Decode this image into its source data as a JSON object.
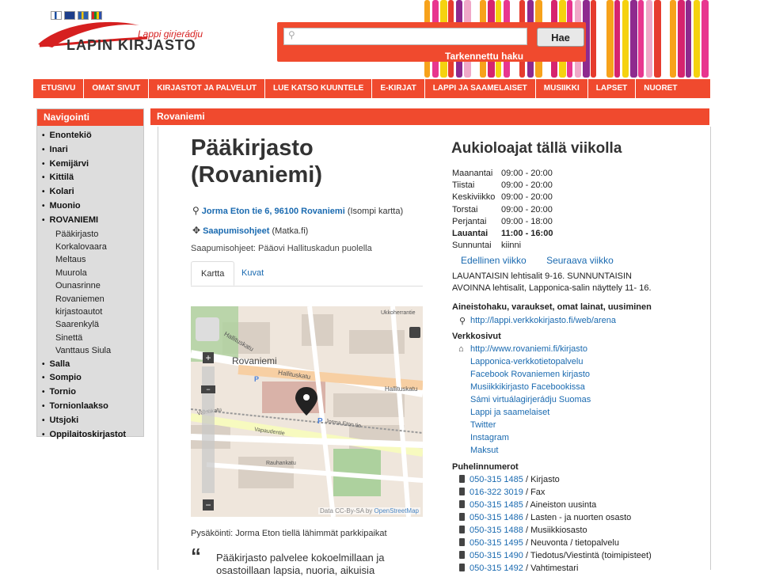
{
  "header": {
    "flags": [
      "fi",
      "gb",
      "se",
      "sa"
    ],
    "logo_sub": "Lappi girjerádju",
    "logo_main": "LAPIN KIRJASTO",
    "search_placeholder": "",
    "search_button": "Hae",
    "advanced_search": "Tarkennettu haku"
  },
  "nav": [
    "ETUSIVU",
    "OMAT SIVUT",
    "KIRJASTOT JA PALVELUT",
    "LUE KATSO KUUNTELE",
    "E-KIRJAT",
    "LAPPI JA SAAMELAISET",
    "MUSIIKKI",
    "LAPSET",
    "NUORET"
  ],
  "sidebar": {
    "title": "Navigointi",
    "items": [
      {
        "label": "Enontekiö",
        "level": "top"
      },
      {
        "label": "Inari",
        "level": "top"
      },
      {
        "label": "Kemijärvi",
        "level": "top"
      },
      {
        "label": "Kittilä",
        "level": "top"
      },
      {
        "label": "Kolari",
        "level": "top"
      },
      {
        "label": "Muonio",
        "level": "top"
      },
      {
        "label": "ROVANIEMI",
        "level": "top"
      },
      {
        "label": "Pääkirjasto",
        "level": "sub"
      },
      {
        "label": "Korkalovaara",
        "level": "sub"
      },
      {
        "label": "Meltaus",
        "level": "sub"
      },
      {
        "label": "Muurola",
        "level": "sub"
      },
      {
        "label": "Ounasrinne",
        "level": "sub"
      },
      {
        "label": "Rovaniemen",
        "level": "sub"
      },
      {
        "label": "kirjastoautot",
        "level": "sub"
      },
      {
        "label": "Saarenkylä",
        "level": "sub"
      },
      {
        "label": "Sinettä",
        "level": "sub"
      },
      {
        "label": "Vanttaus Siula",
        "level": "sub"
      },
      {
        "label": "Salla",
        "level": "top"
      },
      {
        "label": "Sompio",
        "level": "top"
      },
      {
        "label": "Tornio",
        "level": "top"
      },
      {
        "label": "Tornionlaakso",
        "level": "top"
      },
      {
        "label": "Utsjoki",
        "level": "top"
      },
      {
        "label": "Oppilaitoskirjastot",
        "level": "top"
      }
    ]
  },
  "main": {
    "section_title": "Rovaniemi",
    "title": "Pääkirjasto (Rovaniemi)",
    "address_link": "Jorma Eton tie 6, 96100 Rovaniemi",
    "address_extra": "(Isompi kartta)",
    "directions_link": "Saapumisohjeet",
    "directions_extra": "(Matka.fi)",
    "arrival": "Saapumisohjeet: Pääovi Hallituskadun puolella",
    "tabs": [
      "Kartta",
      "Kuvat"
    ],
    "map": {
      "labels": [
        "Rovaniemi",
        "Hallituskatu",
        "Hallituskatu",
        "Hallituskatu",
        "Jorma Eton tie",
        "Väinäkatu",
        "Vapaudentie",
        "Rauhankatu",
        "Ukkoherrantie"
      ],
      "credit_prefix": "Data CC-By-SA by",
      "credit_link": "OpenStreetMap",
      "zoom_in": "+",
      "zoom_out": "−",
      "zoom_out_bottom": "−"
    },
    "parking": "Pysäköinti: Jorma Eton tiellä lähimmät parkkipaikat",
    "quote": "Pääkirjasto palvelee kokoelmillaan ja osastoillaan lapsia, nuoria, aikuisia"
  },
  "hours": {
    "title": "Aukioloajat tällä viikolla",
    "rows": [
      {
        "day": "Maanantai",
        "time": "09:00 - 20:00",
        "today": false
      },
      {
        "day": "Tiistai",
        "time": "09:00 - 20:00",
        "today": false
      },
      {
        "day": "Keskiviikko",
        "time": "09:00 - 20:00",
        "today": false
      },
      {
        "day": "Torstai",
        "time": "09:00 - 20:00",
        "today": false
      },
      {
        "day": "Perjantai",
        "time": "09:00 - 18:00",
        "today": false
      },
      {
        "day": "Lauantai",
        "time": "11:00 - 16:00",
        "today": true
      },
      {
        "day": "Sunnuntai",
        "time": "kiinni",
        "today": false
      }
    ],
    "prev_week": "Edellinen viikko",
    "next_week": "Seuraava viikko",
    "notice": "LAUANTAISIN lehtisalit 9-16. SUNNUNTAISIN AVOINNA lehtisalit, Lapponica-salin näyttely 11- 16."
  },
  "services": {
    "heading": "Aineistohaku, varaukset, omat lainat, uusiminen",
    "link": "http://lappi.verkkokirjasto.fi/web/arena"
  },
  "websites": {
    "heading": "Verkkosivut",
    "links": [
      "http://www.rovaniemi.fi/kirjasto",
      "Lapponica-verkkotietopalvelu",
      "Facebook Rovaniemen kirjasto",
      "Musiikkikirjasto Facebookissa",
      "Sámi virtuálagirjerádju Suomas",
      "Lappi ja saamelaiset",
      "Twitter",
      "Instagram",
      "Maksut"
    ]
  },
  "phones": {
    "heading": "Puhelinnumerot",
    "rows": [
      {
        "number": "050-315 1485",
        "desc": "/ Kirjasto"
      },
      {
        "number": "016-322 3019",
        "desc": "/ Fax"
      },
      {
        "number": "050-315 1485",
        "desc": "/ Aineiston uusinta"
      },
      {
        "number": "050-315 1486",
        "desc": "/ Lasten - ja nuorten osasto"
      },
      {
        "number": "050-315 1488",
        "desc": "/ Musiikkiosasto"
      },
      {
        "number": "050-315 1495",
        "desc": "/ Neuvonta / tietopalvelu"
      },
      {
        "number": "050-315 1490",
        "desc": "/ Tiedotus/Viestintä (toimipisteet)"
      },
      {
        "number": "050-315 1492",
        "desc": "/ Vahtimestari"
      }
    ]
  }
}
